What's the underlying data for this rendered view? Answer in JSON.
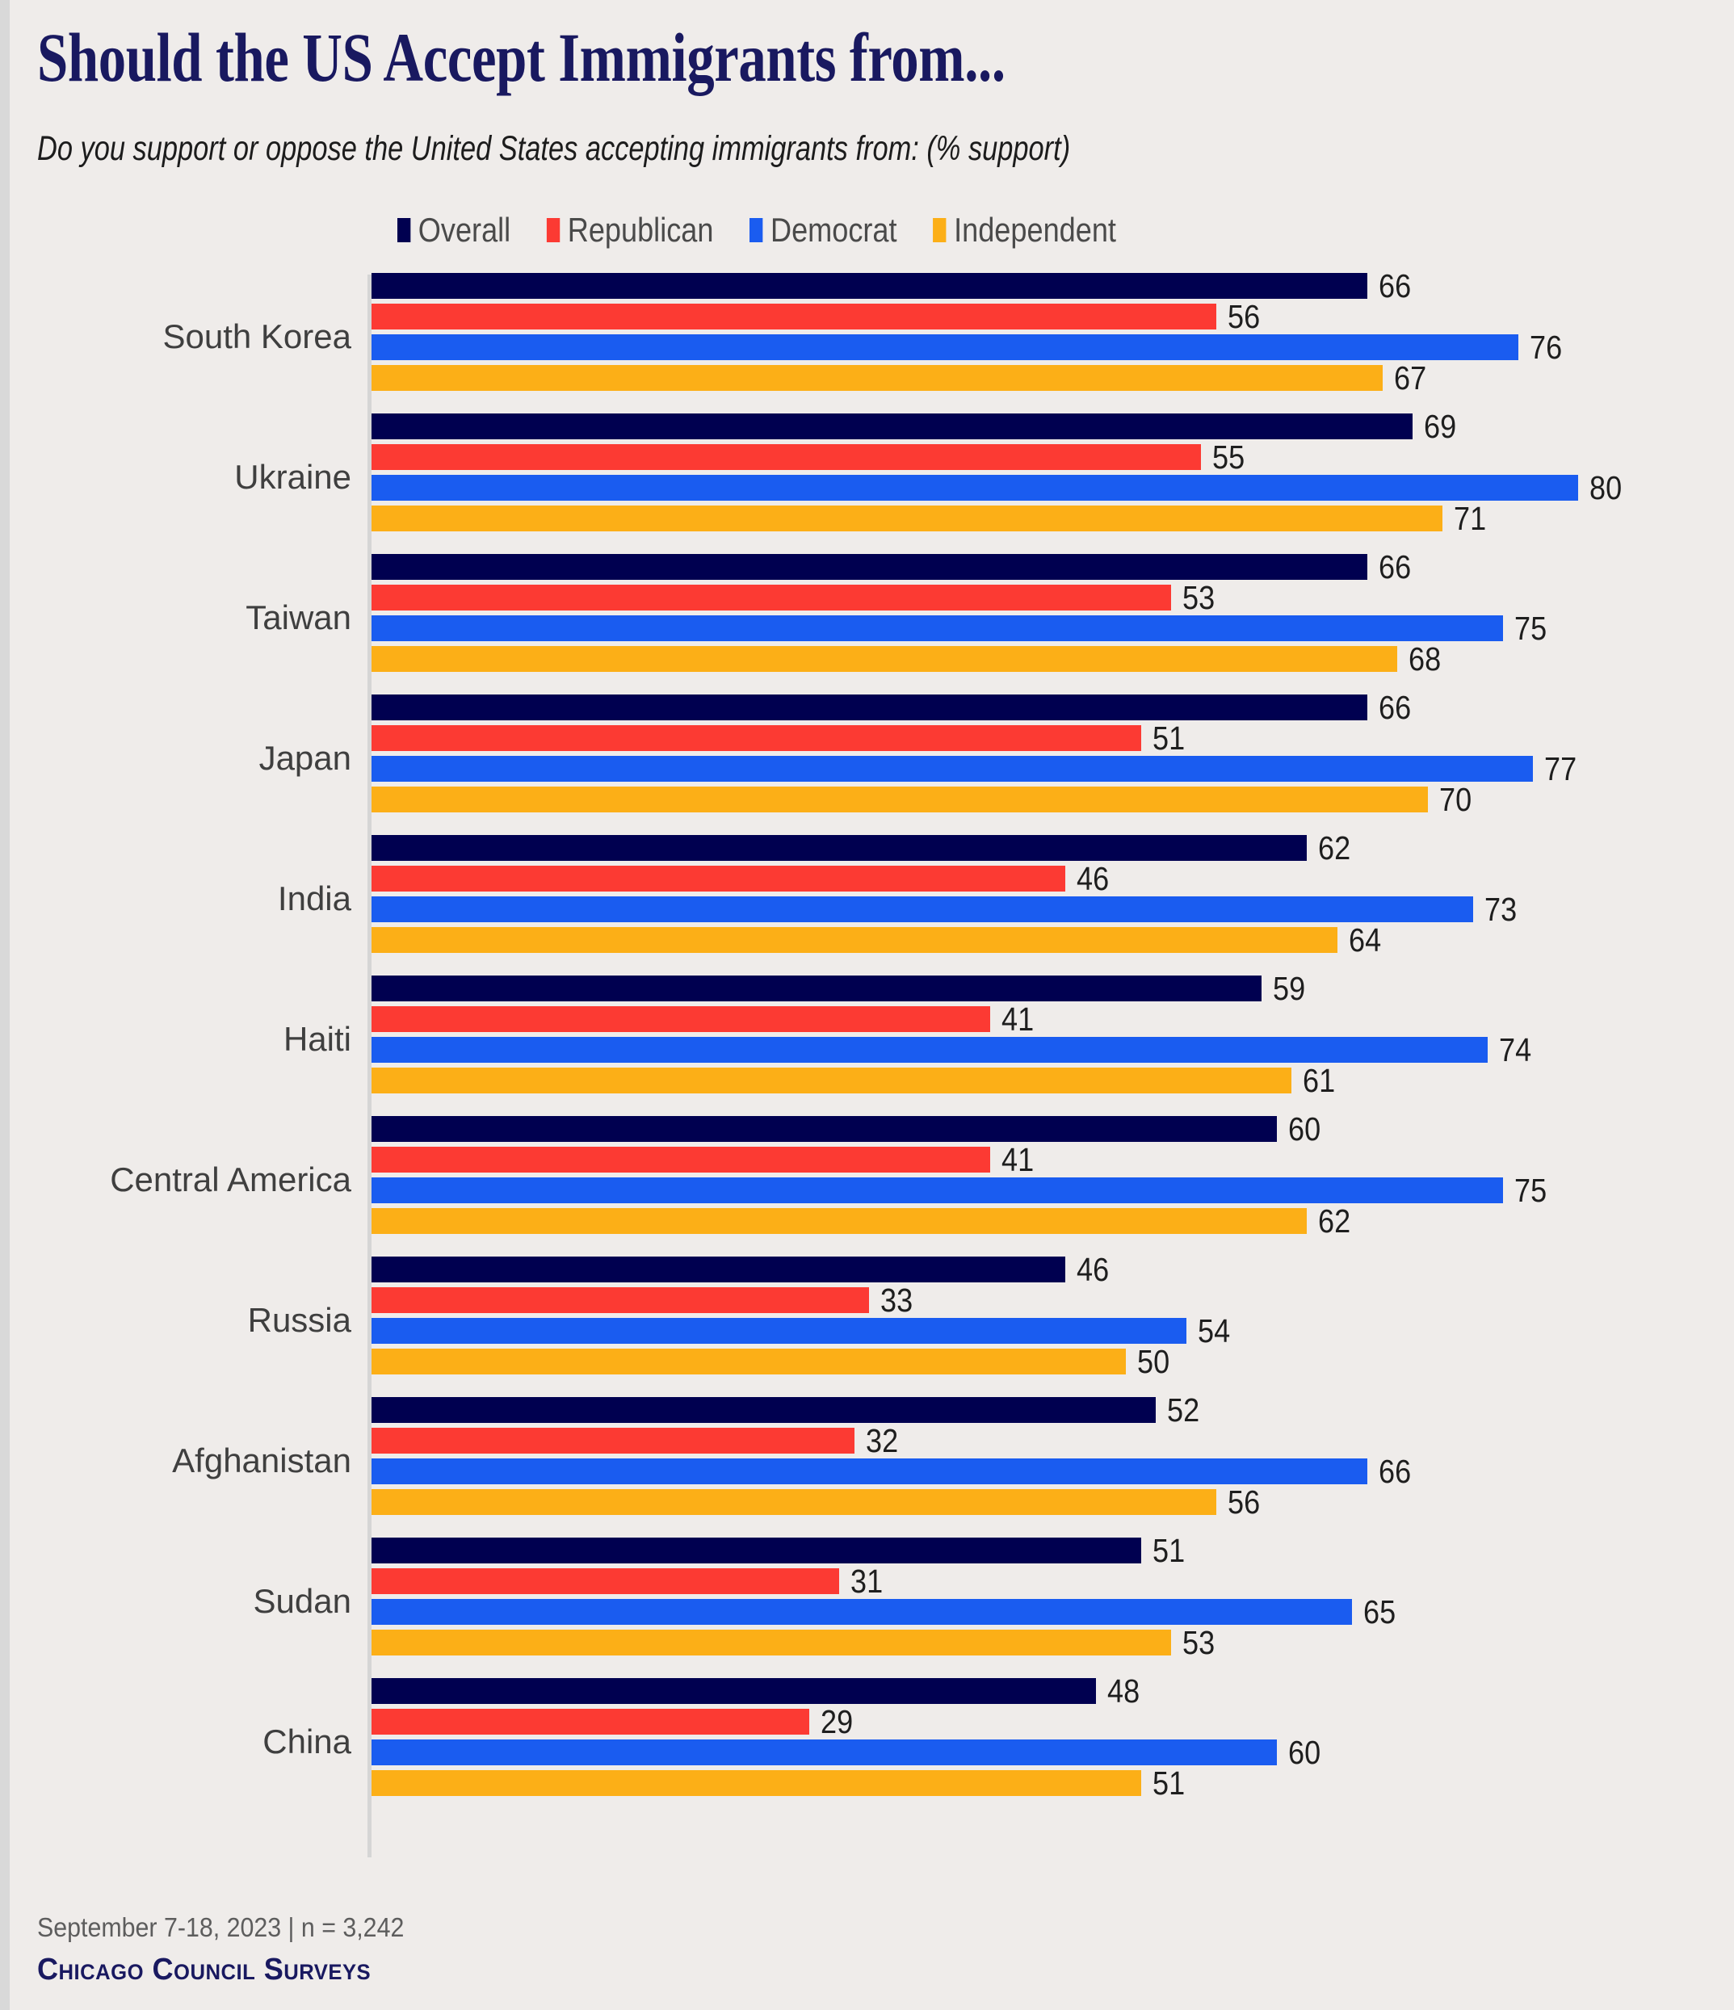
{
  "header": {
    "title": "Should the US Accept Immigrants from...",
    "subtitle": "Do you support or oppose the United States accepting immigrants from: (% support)"
  },
  "footer": {
    "note": "September 7-18, 2023 | n = 3,242",
    "brand": "Chicago Council Surveys"
  },
  "colors": {
    "background": "#efecea",
    "overall": "#000050",
    "republican": "#fc3a33",
    "democrat": "#1a5cf0",
    "independent": "#fcaf17",
    "title": "#191960",
    "axis": "#d5d5d5"
  },
  "legend": [
    {
      "label": "Overall",
      "color": "#000050",
      "name": "legend-overall"
    },
    {
      "label": "Republican",
      "color": "#fc3a33",
      "name": "legend-republican"
    },
    {
      "label": "Democrat",
      "color": "#1a5cf0",
      "name": "legend-democrat"
    },
    {
      "label": "Independent",
      "color": "#fcaf17",
      "name": "legend-independent"
    }
  ],
  "chart_data": {
    "type": "bar",
    "orientation": "horizontal",
    "title": "Should the US Accept Immigrants from...",
    "subtitle": "Do you support or oppose the United States accepting immigrants from: (% support)",
    "xlabel": "",
    "ylabel": "",
    "xlim": [
      0,
      80
    ],
    "grid": false,
    "legend_position": "top",
    "value_suffix": "%",
    "categories": [
      "South Korea",
      "Ukraine",
      "Taiwan",
      "Japan",
      "India",
      "Haiti",
      "Central America",
      "Russia",
      "Afghanistan",
      "Sudan",
      "China"
    ],
    "series": [
      {
        "name": "Overall",
        "color": "#000050",
        "values": [
          66,
          69,
          66,
          66,
          62,
          59,
          60,
          46,
          52,
          51,
          48
        ]
      },
      {
        "name": "Republican",
        "color": "#fc3a33",
        "values": [
          56,
          55,
          53,
          51,
          46,
          41,
          41,
          33,
          32,
          31,
          29
        ]
      },
      {
        "name": "Democrat",
        "color": "#1a5cf0",
        "values": [
          76,
          80,
          75,
          77,
          73,
          74,
          75,
          54,
          66,
          65,
          60
        ]
      },
      {
        "name": "Independent",
        "color": "#fcaf17",
        "values": [
          67,
          71,
          68,
          70,
          64,
          61,
          62,
          50,
          56,
          53,
          51
        ]
      }
    ]
  }
}
